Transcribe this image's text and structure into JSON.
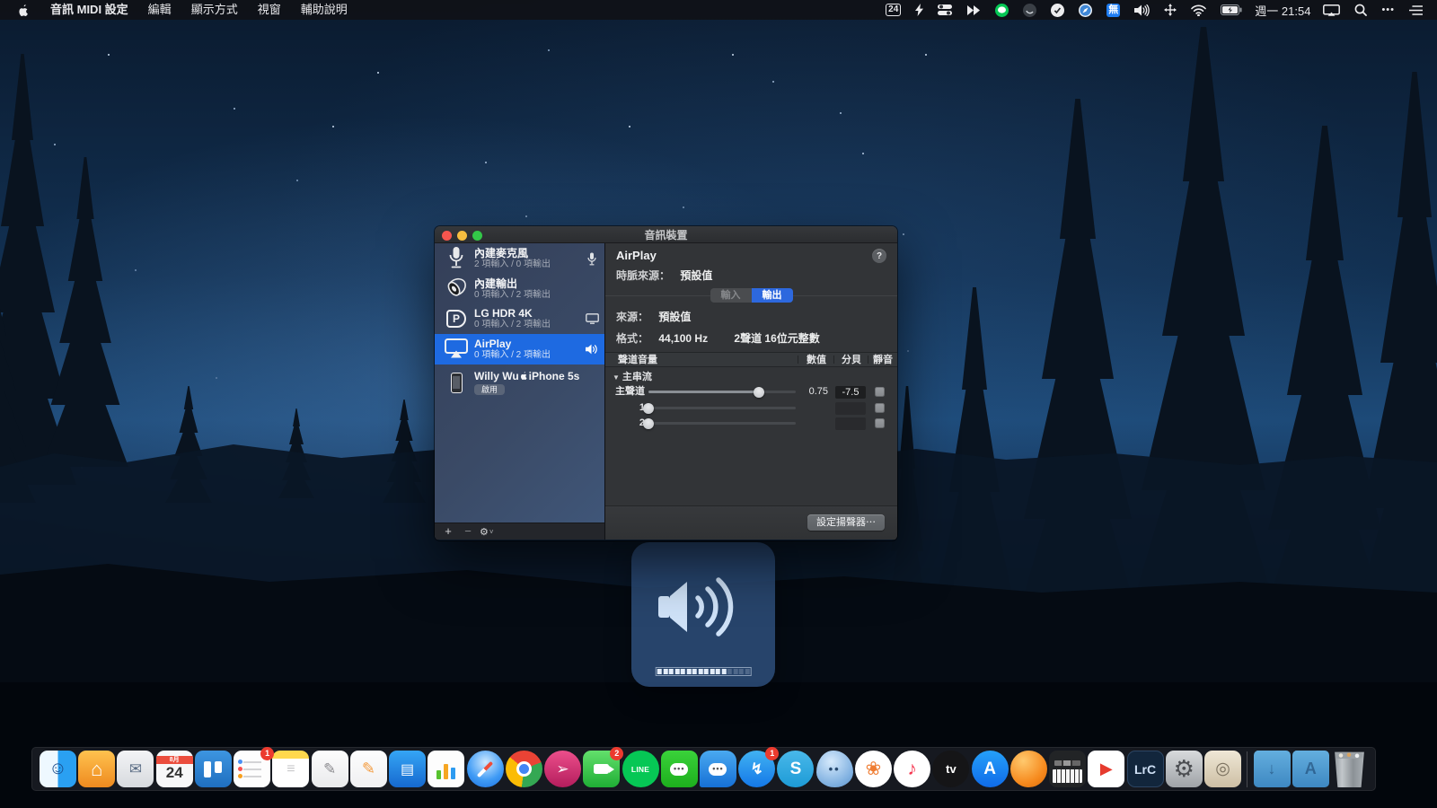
{
  "menu_bar": {
    "menus": [
      {
        "label": "音訊 MIDI 設定",
        "bold": true
      },
      {
        "label": "編輯",
        "bold": false
      },
      {
        "label": "顯示方式",
        "bold": false
      },
      {
        "label": "視窗",
        "bold": false
      },
      {
        "label": "輔助說明",
        "bold": false
      }
    ],
    "status_items": [
      {
        "name": "calendar-date-icon",
        "text": "24"
      },
      {
        "name": "bolt-icon"
      },
      {
        "name": "toggles-icon"
      },
      {
        "name": "chevrons-icon"
      },
      {
        "name": "line-status-icon"
      },
      {
        "name": "orb-icon"
      },
      {
        "name": "check-circle-icon"
      },
      {
        "name": "compass-icon"
      },
      {
        "name": "input-method-icon",
        "text": "無"
      },
      {
        "name": "volume-icon"
      },
      {
        "name": "spatial-audio-icon"
      },
      {
        "name": "wifi-icon"
      },
      {
        "name": "battery-icon"
      },
      {
        "name": "clock",
        "text": "週一 21:54"
      },
      {
        "name": "screen-mirroring-icon"
      },
      {
        "name": "search-icon"
      },
      {
        "name": "more-icon",
        "text": "•••"
      },
      {
        "name": "list-icon"
      }
    ]
  },
  "window": {
    "title": "音訊裝置",
    "sidebar": {
      "devices": [
        {
          "name": "內建麥克風",
          "detail": "2 項輸入 / 0 項輸出",
          "icon": "microphone-icon",
          "trailing": "mic",
          "selected": false
        },
        {
          "name": "內建輸出",
          "detail": "0 項輸入 / 2 項輸出",
          "icon": "speaker-icon",
          "trailing": "none",
          "selected": false
        },
        {
          "name": "LG HDR 4K",
          "detail": "0 項輸入 / 2 項輸出",
          "icon": "displayport-icon",
          "trailing": "display",
          "selected": false
        },
        {
          "name": "AirPlay",
          "detail": "0 項輸入 / 2 項輸出",
          "icon": "airplay-icon",
          "trailing": "speaker",
          "selected": true
        },
        {
          "name": "Willy Wu",
          "name_suffix": "iPhone 5s",
          "badge": "啟用",
          "icon": "iphone-icon",
          "trailing": "none",
          "selected": false
        }
      ],
      "toolbar": {
        "add": "+",
        "remove": "−",
        "gear": "⚙",
        "chevron": "˅"
      }
    },
    "detail": {
      "device_name": "AirPlay",
      "help": "?",
      "clock_source_label": "時脈來源：",
      "clock_source_value": "預設值",
      "tabs": [
        {
          "label": "輸入",
          "active": false
        },
        {
          "label": "輸出",
          "active": true
        }
      ],
      "source_label": "來源：",
      "source_value": "預設值",
      "format_label": "格式：",
      "format_rate": "44,100 Hz",
      "format_channels": "2聲道 16位元整數",
      "table": {
        "header": {
          "channel": "聲道音量",
          "value": "數值",
          "db": "分貝",
          "mute": "靜音"
        },
        "group": "主串流",
        "rows": [
          {
            "label": "主聲道",
            "slider": 0.75,
            "value_text": "0.75",
            "db_text": "-7.5",
            "has_db_box": true,
            "muted": false
          },
          {
            "label": "1",
            "slider": 0,
            "value_text": "",
            "db_text": "",
            "has_db_box": true,
            "muted": false
          },
          {
            "label": "2",
            "slider": 0,
            "value_text": "",
            "db_text": "",
            "has_db_box": true,
            "muted": false
          }
        ]
      },
      "configure_speakers": "設定揚聲器⋯"
    }
  },
  "volume_hud": {
    "segments": 16,
    "filled": 12
  },
  "dock": {
    "items": [
      {
        "id": "finder",
        "name": "finder"
      },
      {
        "id": "home",
        "name": "home"
      },
      {
        "id": "mail",
        "name": "mail"
      },
      {
        "id": "calendar",
        "name": "calendar",
        "month": "8月",
        "day": "24"
      },
      {
        "id": "trello",
        "name": "trello"
      },
      {
        "id": "reminders",
        "name": "reminders",
        "badge": "1"
      },
      {
        "id": "notes",
        "name": "notes"
      },
      {
        "id": "textedit",
        "name": "textedit"
      },
      {
        "id": "pages",
        "name": "pages"
      },
      {
        "id": "keynote",
        "name": "keynote"
      },
      {
        "id": "numbers",
        "name": "numbers"
      },
      {
        "id": "safari",
        "name": "safari"
      },
      {
        "id": "chrome",
        "name": "chrome"
      },
      {
        "id": "skitch",
        "name": "skitch"
      },
      {
        "id": "facetime",
        "name": "facetime",
        "badge": "2"
      },
      {
        "id": "line",
        "name": "line",
        "text": "LINE"
      },
      {
        "id": "wechat",
        "name": "wechat"
      },
      {
        "id": "bluechat",
        "name": "blue-chat"
      },
      {
        "id": "messenger",
        "name": "messenger",
        "badge": "1"
      },
      {
        "id": "skype",
        "name": "skype",
        "text": "S"
      },
      {
        "id": "ghost",
        "name": "ghost-chat"
      },
      {
        "id": "photos",
        "name": "photos"
      },
      {
        "id": "music",
        "name": "music"
      },
      {
        "id": "appletv",
        "name": "apple-tv",
        "text": "tv"
      },
      {
        "id": "appstore",
        "name": "app-store",
        "text": "A"
      },
      {
        "id": "orange",
        "name": "orange-app"
      },
      {
        "id": "midi",
        "name": "audio-midi-setup"
      },
      {
        "id": "play",
        "name": "video-player"
      },
      {
        "id": "lrc",
        "name": "lightroom-classic",
        "text": "LrC"
      },
      {
        "id": "prefs",
        "name": "system-preferences"
      },
      {
        "id": "preview",
        "name": "preview"
      },
      {
        "id": "sep",
        "name": "dock-separator"
      },
      {
        "id": "folder-dl",
        "name": "downloads-folder"
      },
      {
        "id": "folder-app",
        "name": "applications-folder"
      },
      {
        "id": "trash",
        "name": "trash"
      }
    ]
  },
  "colors": {
    "accent_blue": "#1e6ae1",
    "tab_blue": "#2d68de",
    "hud_bg": "rgba(47,82,130,0.80)",
    "panel_bg": "#323437",
    "sidebar_selected": "#1e6ae1"
  }
}
